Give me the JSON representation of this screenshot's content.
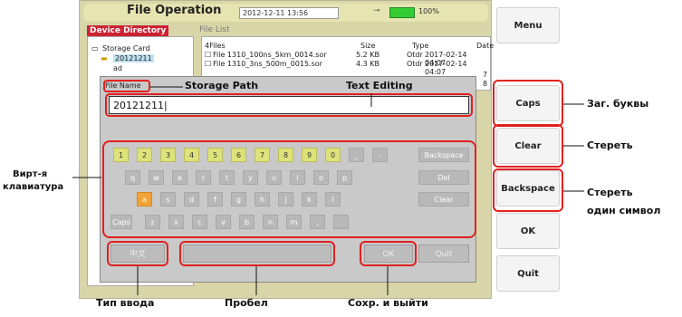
{
  "screen": {
    "title": "File Operation",
    "datetime": "2012-12-11 13:56",
    "battery": "100%",
    "device_directory": "Device Directory",
    "file_list_title": "File List"
  },
  "tree": {
    "root": "Storage Card",
    "selected": "20121211",
    "partial": "ad"
  },
  "file_list": {
    "headers": [
      "4Files",
      "Size",
      "Type",
      "Date"
    ],
    "rows": [
      [
        "File 1310_100ns_5km_0014.sor",
        "5.2 KB",
        "Otdr",
        "2017-02-14 04:07"
      ],
      [
        "File 1310_3ns_500m_0015.sor",
        "4.3 KB",
        "Otdr",
        "2017-02-14 04:07"
      ]
    ],
    "partial_chars": [
      "7",
      "8"
    ]
  },
  "dialog": {
    "file_name_label": "File Name",
    "text_value": "20121211|"
  },
  "keyboard": {
    "row1": [
      "1",
      "2",
      "3",
      "4",
      "5",
      "6",
      "7",
      "8",
      "9",
      "0",
      "_",
      "-",
      "Backspace"
    ],
    "row2": [
      "q",
      "w",
      "e",
      "r",
      "t",
      "y",
      "u",
      "i",
      "o",
      "p",
      "Del"
    ],
    "row3": [
      "a",
      "s",
      "d",
      "f",
      "g",
      "h",
      "j",
      "k",
      "l",
      "Clear"
    ],
    "row4": [
      "Caps",
      "z",
      "x",
      "c",
      "v",
      "b",
      "n",
      "m",
      ",",
      "."
    ]
  },
  "bottom": {
    "input_type": "中文",
    "ok": "OK",
    "quit": "Quit"
  },
  "side": {
    "menu": "Menu",
    "caps": "Caps",
    "clear": "Clear",
    "backspace": "Backspace",
    "ok": "OK",
    "quit": "Quit"
  },
  "annotations": {
    "storage_path": "Storage Path",
    "text_editing": "Text Editing",
    "caps_ru": "Заг. буквы",
    "clear_ru": "Стереть",
    "backspace_ru_1": "Стереть",
    "backspace_ru_2": "один символ",
    "virt_kbd_1": "Вирт-я",
    "virt_kbd_2": "клавиатура",
    "input_type_ru": "Тип ввода",
    "space_ru": "Пробел",
    "save_exit_ru": "Сохр. и выйти"
  },
  "colors": {
    "highlight": "#e02020",
    "number_key": "#dde27a",
    "active_key": "#f1a338",
    "battery": "#33cc33"
  }
}
